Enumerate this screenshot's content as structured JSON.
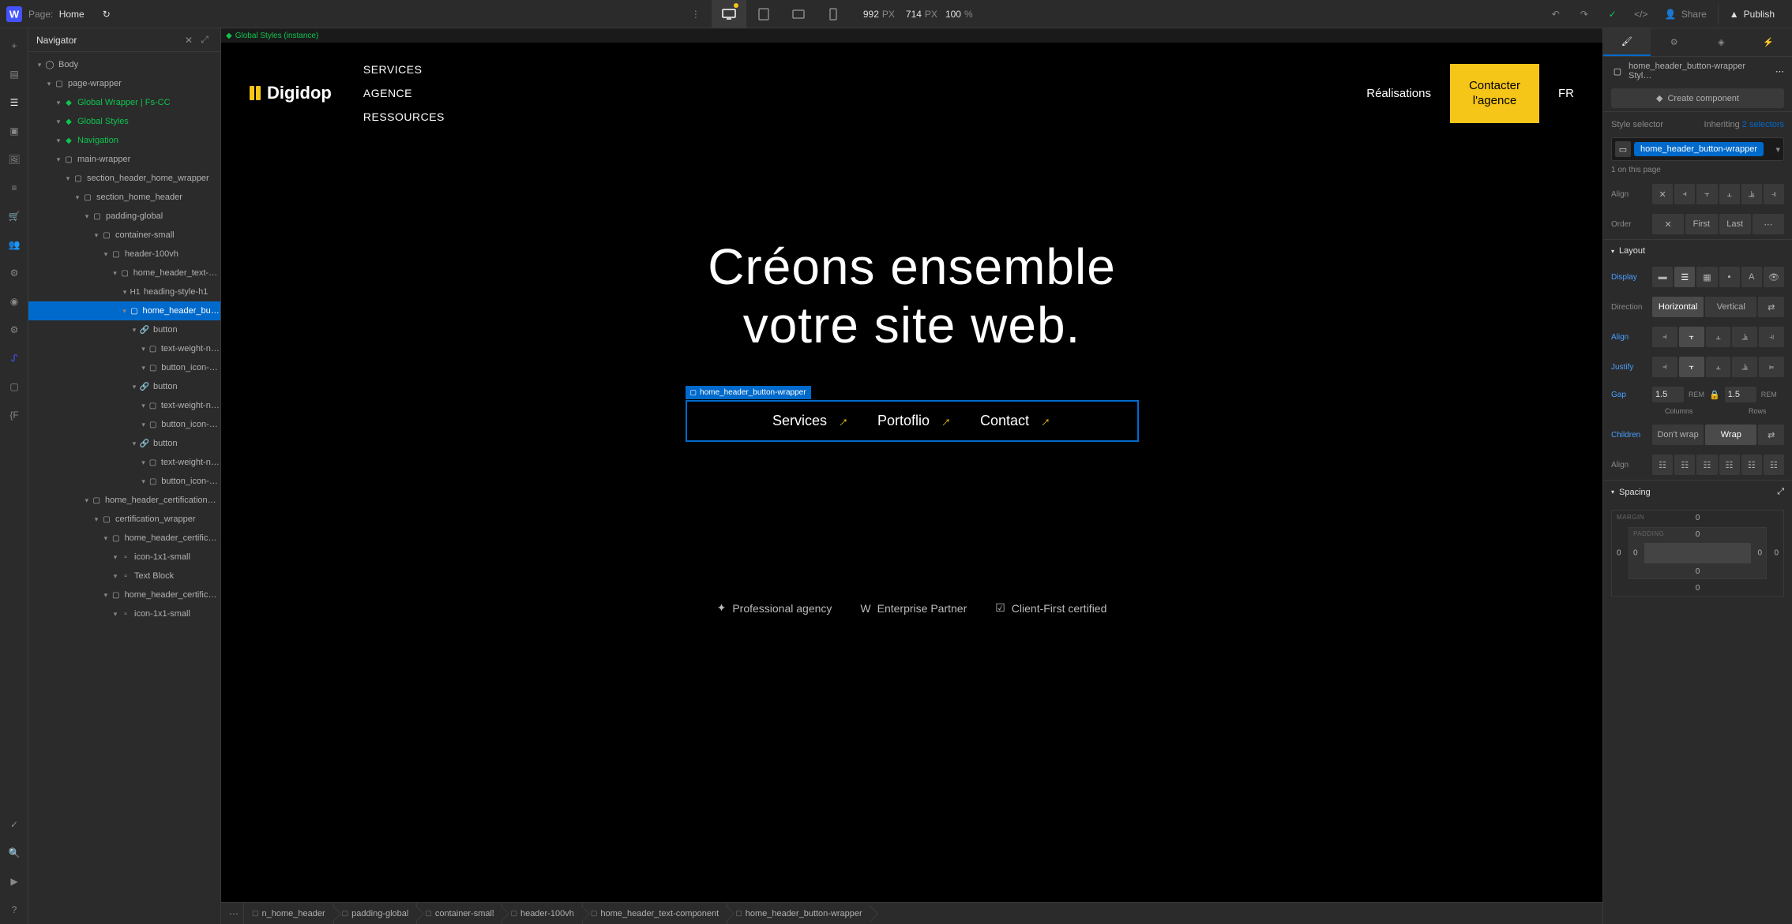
{
  "topbar": {
    "page_label": "Page:",
    "page_name": "Home",
    "width": "992",
    "width_unit": "PX",
    "height": "714",
    "height_unit": "PX",
    "zoom": "100",
    "zoom_unit": "%",
    "share": "Share",
    "publish": "Publish"
  },
  "navigator": {
    "title": "Navigator",
    "tree": [
      {
        "l": "Body",
        "d": 0,
        "i": "◯",
        "sym": false
      },
      {
        "l": "page-wrapper",
        "d": 1,
        "i": "▢",
        "sym": false
      },
      {
        "l": "Global Wrapper | Fs-CC",
        "d": 2,
        "i": "◆",
        "sym": true
      },
      {
        "l": "Global Styles",
        "d": 2,
        "i": "◆",
        "sym": true
      },
      {
        "l": "Navigation",
        "d": 2,
        "i": "◆",
        "sym": true
      },
      {
        "l": "main-wrapper",
        "d": 2,
        "i": "▢",
        "sym": false
      },
      {
        "l": "section_header_home_wrapper",
        "d": 3,
        "i": "▢",
        "sym": false
      },
      {
        "l": "section_home_header",
        "d": 4,
        "i": "▢",
        "sym": false
      },
      {
        "l": "padding-global",
        "d": 5,
        "i": "▢",
        "sym": false
      },
      {
        "l": "container-small",
        "d": 6,
        "i": "▢",
        "sym": false
      },
      {
        "l": "header-100vh",
        "d": 7,
        "i": "▢",
        "sym": false
      },
      {
        "l": "home_header_text-com",
        "d": 8,
        "i": "▢",
        "sym": false
      },
      {
        "l": "heading-style-h1",
        "d": 9,
        "i": "H1",
        "sym": false
      },
      {
        "l": "home_header_button",
        "d": 9,
        "i": "▢",
        "sym": false,
        "sel": true
      },
      {
        "l": "button",
        "d": 10,
        "i": "🔗",
        "sym": false
      },
      {
        "l": "text-weight-norm",
        "d": 11,
        "i": "▢",
        "sym": false
      },
      {
        "l": "button_icon-arro",
        "d": 11,
        "i": "▢",
        "sym": false
      },
      {
        "l": "button",
        "d": 10,
        "i": "🔗",
        "sym": false
      },
      {
        "l": "text-weight-norm",
        "d": 11,
        "i": "▢",
        "sym": false
      },
      {
        "l": "button_icon-arro",
        "d": 11,
        "i": "▢",
        "sym": false
      },
      {
        "l": "button",
        "d": 10,
        "i": "🔗",
        "sym": false
      },
      {
        "l": "text-weight-norm",
        "d": 11,
        "i": "▢",
        "sym": false
      },
      {
        "l": "button_icon-arro",
        "d": 11,
        "i": "▢",
        "sym": false
      },
      {
        "l": "home_header_certification_gro",
        "d": 5,
        "i": "▢",
        "sym": false
      },
      {
        "l": "certification_wrapper",
        "d": 6,
        "i": "▢",
        "sym": false
      },
      {
        "l": "home_header_certificatio",
        "d": 7,
        "i": "▢",
        "sym": false
      },
      {
        "l": "icon-1x1-small",
        "d": 8,
        "i": "▫",
        "sym": false
      },
      {
        "l": "Text Block",
        "d": 8,
        "i": "▫",
        "sym": false
      },
      {
        "l": "home_header_certificatio",
        "d": 7,
        "i": "▢",
        "sym": false
      },
      {
        "l": "icon-1x1-small",
        "d": 8,
        "i": "▫",
        "sym": false
      }
    ]
  },
  "canvas": {
    "indicator": "Global Styles (instance)",
    "brand": "Digidop",
    "nav": {
      "services": "SERVICES",
      "agence": "AGENCE",
      "ressources": "RESSOURCES",
      "realisations": "Réalisations",
      "cta1": "Contacter",
      "cta2": "l'agence",
      "lang": "FR"
    },
    "hero": {
      "line1": "Créons ensemble",
      "line2": "votre site web."
    },
    "buttons": [
      {
        "l": "Services"
      },
      {
        "l": "Portoflio"
      },
      {
        "l": "Contact"
      }
    ],
    "sel_label": "home_header_button-wrapper",
    "certs": [
      {
        "l": "Professional agency"
      },
      {
        "l": "Enterprise Partner"
      },
      {
        "l": "Client-First certified"
      }
    ]
  },
  "breadcrumbs": [
    "n_home_header",
    "padding-global",
    "container-small",
    "header-100vh",
    "home_header_text-component",
    "home_header_button-wrapper"
  ],
  "right": {
    "class_name": "home_header_button-wrapper Styl…",
    "create_component": "Create component",
    "style_selector": "Style selector",
    "inheriting": "Inheriting",
    "inherit_n": "2 selectors",
    "tag": "home_header_button-wrapper",
    "hint": "1 on this page",
    "align": "Align",
    "order": "Order",
    "first": "First",
    "last": "Last",
    "layout": "Layout",
    "display": "Display",
    "direction": "Direction",
    "horizontal": "Horizontal",
    "vertical": "Vertical",
    "justify": "Justify",
    "gap": "Gap",
    "gap_col": "1.5",
    "gap_row": "1.5",
    "gap_unit": "REM",
    "columns": "Columns",
    "rows": "Rows",
    "children": "Children",
    "dont_wrap": "Don't wrap",
    "wrap": "Wrap",
    "spacing": "Spacing",
    "margin": "MARGIN",
    "padding": "PADDING",
    "zero": "0"
  }
}
